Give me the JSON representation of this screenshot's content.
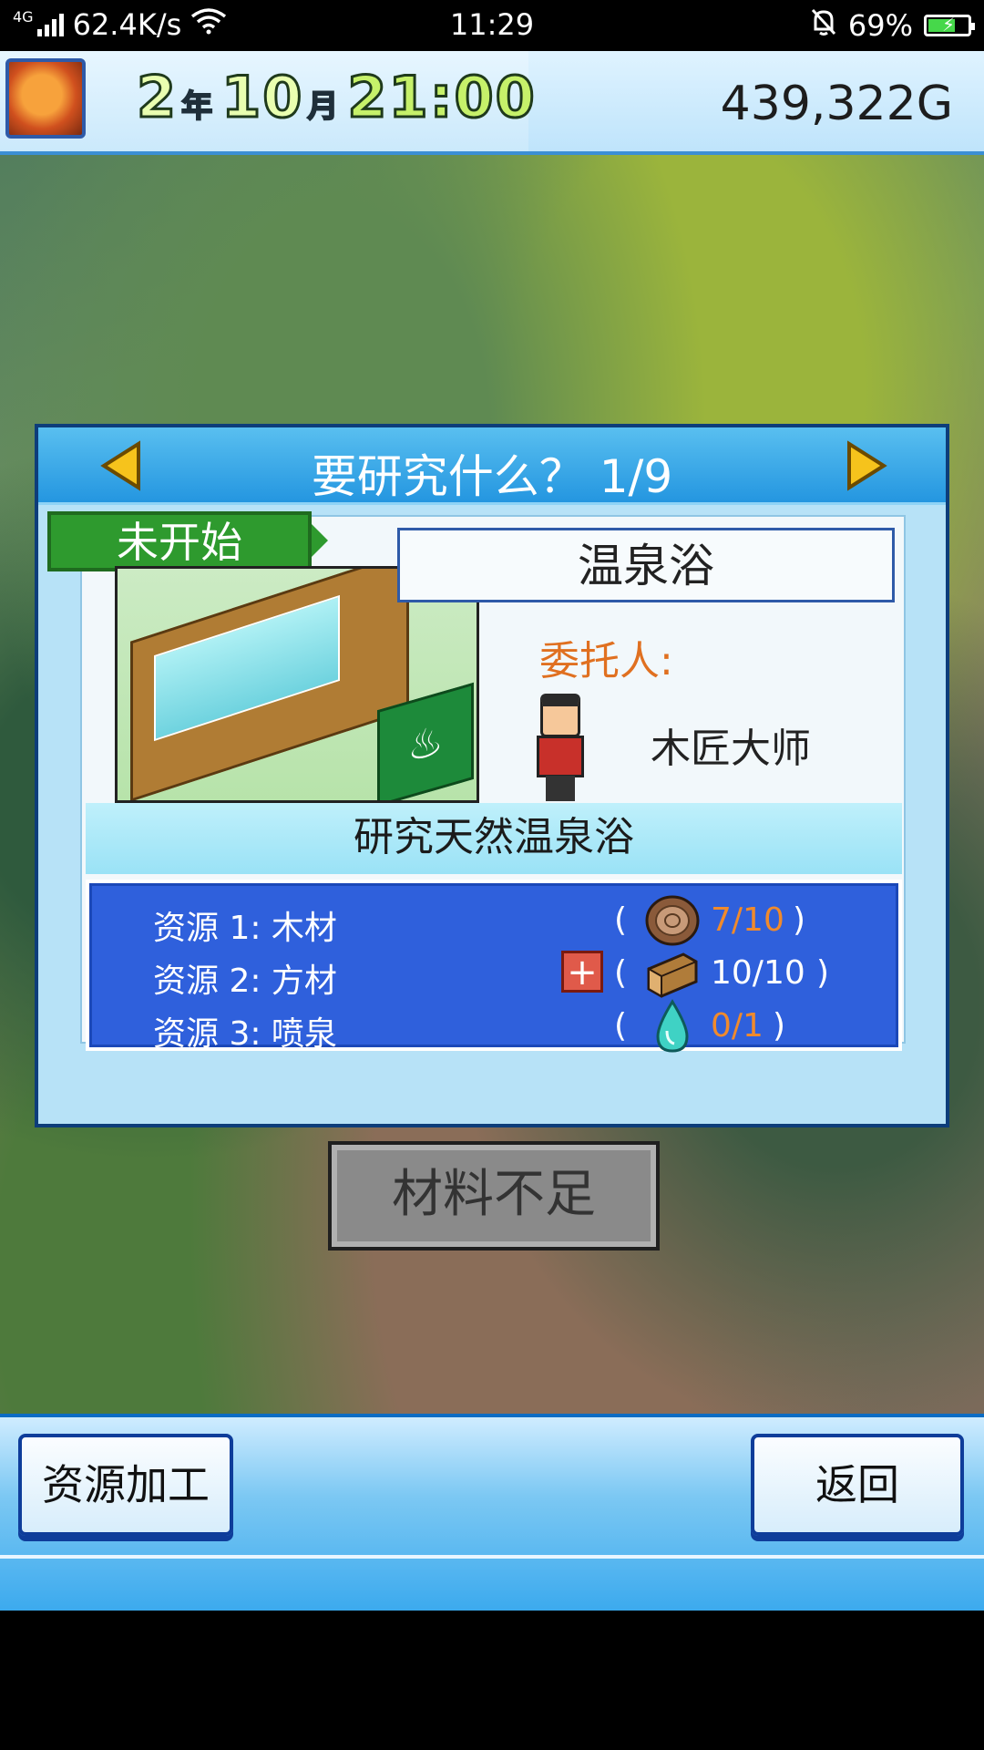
{
  "status_bar": {
    "network_type": "4G",
    "net_speed": "62.4K/s",
    "time": "11:29",
    "battery": "69%",
    "battery_level": 0.69
  },
  "hud": {
    "year": "2",
    "year_unit": "年",
    "month": "10",
    "month_unit": "月",
    "clock": "21:00",
    "gold": "439,322G"
  },
  "research": {
    "title": "要研究什么？ 1/9",
    "status": "未开始",
    "facility_name": "温泉浴",
    "client_label": "委托人:",
    "client_name": "木匠大师",
    "description": "研究天然温泉浴",
    "resources": [
      {
        "label": "资源 1: 木材",
        "icon": "log-icon",
        "count": "7/10",
        "insufficient": true,
        "paren_open": "(",
        "paren_close": ")"
      },
      {
        "label": "资源 2: 方材",
        "icon": "plank-icon",
        "count": "10/10",
        "insufficient": false,
        "has_plus": true,
        "plus": "+",
        "paren_open": "(",
        "paren_close": ")"
      },
      {
        "label": "资源 3: 喷泉",
        "icon": "water-drop-icon",
        "count": "0/1",
        "insufficient": true,
        "paren_open": "(",
        "paren_close": ")"
      }
    ],
    "action_button": "材料不足"
  },
  "bottom": {
    "left_button": "资源加工",
    "right_button": "返回"
  },
  "colors": {
    "accent_blue": "#2496e0",
    "resource_panel": "#2f60dc",
    "status_green": "#2e9a2e",
    "insufficient_orange": "#f08a2c",
    "client_label_orange": "#e07020"
  }
}
